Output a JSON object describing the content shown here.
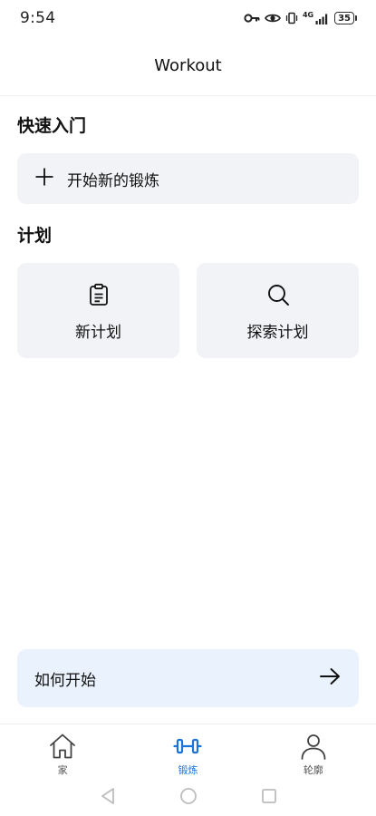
{
  "status_bar": {
    "time": "9:54",
    "network": "4G",
    "battery": "35"
  },
  "header": {
    "title": "Workout"
  },
  "quick_start": {
    "section_title": "快速入门",
    "start_button_label": "开始新的锻炼",
    "icon": "plus-icon"
  },
  "plans": {
    "section_title": "计划",
    "cards": [
      {
        "label": "新计划",
        "icon": "clipboard-icon"
      },
      {
        "label": "探索计划",
        "icon": "search-icon"
      }
    ]
  },
  "howto": {
    "label": "如何开始",
    "icon": "arrow-right-icon",
    "background": "#eaf3fd"
  },
  "bottom_nav": {
    "items": [
      {
        "label": "家",
        "icon": "home-icon",
        "active": false
      },
      {
        "label": "锻炼",
        "icon": "dumbbell-icon",
        "active": true
      },
      {
        "label": "轮廓",
        "icon": "person-icon",
        "active": false
      }
    ],
    "active_color": "#1a73d9"
  },
  "system_nav": {
    "icons": [
      "back-triangle-icon",
      "home-circle-icon",
      "recents-square-icon"
    ]
  }
}
